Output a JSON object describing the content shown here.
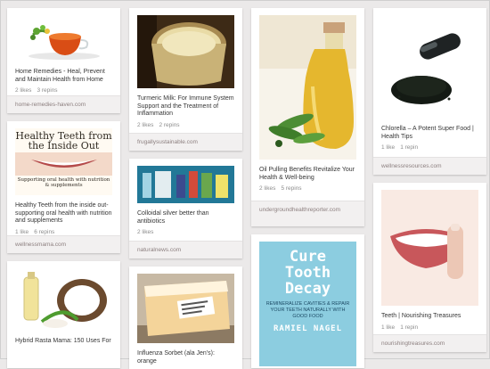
{
  "pins": [
    {
      "id": "tea",
      "description": "Home Remedies - Heal, Prevent and Maintain Health from Home",
      "likes": "2 likes",
      "repins": "3 repins",
      "source": "home-remedies-haven.com"
    },
    {
      "id": "teeth-book",
      "image_title_1": "Healthy Teeth from",
      "image_title_2": "the Inside Out",
      "image_subtitle": "Supporting oral health with nutrition & supplements",
      "description": "Healthy Teeth from the inside out- supporting oral health with nutrition and supplements",
      "likes": "1 like",
      "repins": "6 repins",
      "source": "wellnessmama.com"
    },
    {
      "id": "coconut",
      "description": "Hybrid Rasta Mama: 150 Uses For",
      "likes": "",
      "repins": "",
      "source": ""
    },
    {
      "id": "turmeric",
      "description": "Turmeric Milk: For Immune System Support and the Treatment of Inflammation",
      "likes": "2 likes",
      "repins": "2 repins",
      "source": "frugallysustainable.com"
    },
    {
      "id": "silver",
      "description": "Colloidal silver better than antibiotics",
      "likes": "2 likes",
      "repins": "",
      "source": "naturalnews.com"
    },
    {
      "id": "sorbet",
      "description": "Influenza Sorbet (ala Jen's): orange",
      "likes": "",
      "repins": "",
      "source": ""
    },
    {
      "id": "oil",
      "description": "Oil Pulling Benefits Revitalize Your Health & Well-being",
      "likes": "2 likes",
      "repins": "5 repins",
      "source": "undergroundhealthreporter.com"
    },
    {
      "id": "cure",
      "book_title_1": "Cure",
      "book_title_2": "Tooth",
      "book_title_3": "Decay",
      "book_sub": "Remineralize Cavities & Repair Your Teeth Naturally with Good Food",
      "book_author": "RAMIEL NAGEL"
    },
    {
      "id": "chlorella",
      "description": "Chlorella – A Potent Super Food | Health Tips",
      "likes": "1 like",
      "repins": "1 repin",
      "source": "wellnessresources.com"
    },
    {
      "id": "smile",
      "description": "Teeth | Nourishing Treasures",
      "likes": "1 like",
      "repins": "1 repin",
      "source": "nourishingtreasures.com"
    }
  ],
  "colors": {
    "background": "#ebe9e9",
    "card": "#ffffff",
    "source_bar": "#f2f0f0",
    "text": "#363636",
    "meta": "#8c8c8c"
  },
  "icons": {
    "tea": "teacup-herbs-image",
    "teeth": "smile-image",
    "coconut": "coconut-oil-image",
    "turmeric": "turmeric-milk-image",
    "silver": "colloidal-silver-bottles-image",
    "sorbet": "sorbet-container-image",
    "oil": "olive-oil-bottle-image",
    "chlorella": "capsule-powder-image",
    "smile": "smiling-mouth-image"
  }
}
